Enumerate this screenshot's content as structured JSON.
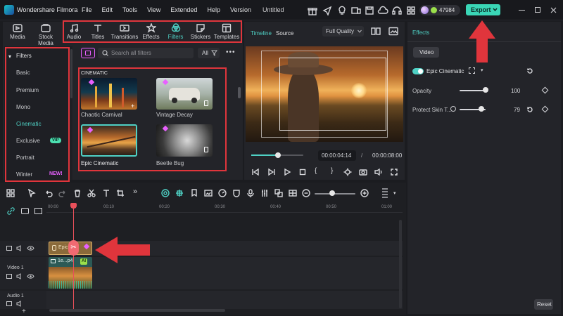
{
  "app": {
    "name": "Wondershare Filmora",
    "menu": [
      "File",
      "Edit",
      "Tools",
      "View",
      "Extended",
      "Help",
      "Version"
    ],
    "doc_title": "Untitled",
    "credits": "47984",
    "export_label": "Export"
  },
  "media_tabs": [
    {
      "label": "Media",
      "icon": "media-icon"
    },
    {
      "label": "Stock Media",
      "icon": "stock-media-icon"
    },
    {
      "label": "Audio",
      "icon": "audio-icon"
    },
    {
      "label": "Titles",
      "icon": "titles-icon"
    },
    {
      "label": "Transitions",
      "icon": "transitions-icon"
    },
    {
      "label": "Effects",
      "icon": "effects-icon"
    },
    {
      "label": "Filters",
      "icon": "filters-icon"
    },
    {
      "label": "Stickers",
      "icon": "stickers-icon"
    },
    {
      "label": "Templates",
      "icon": "templates-icon"
    }
  ],
  "filters_sidebar": {
    "header": "Filters",
    "items": [
      {
        "label": "Basic"
      },
      {
        "label": "Premium"
      },
      {
        "label": "Mono"
      },
      {
        "label": "Cinematic",
        "active": true
      },
      {
        "label": "Exclusive",
        "badge": "VIP"
      },
      {
        "label": "Portrait"
      },
      {
        "label": "Winter",
        "badge": "NEW!"
      }
    ]
  },
  "search": {
    "placeholder": "Search all filters",
    "filter_label": "All"
  },
  "filter_grid": {
    "section": "CINEMATIC",
    "items": [
      {
        "name": "Chaotic Carnival"
      },
      {
        "name": "Vintage Decay"
      },
      {
        "name": "Epic Cinematic",
        "selected": true
      },
      {
        "name": "Beetle Bug"
      }
    ]
  },
  "preview": {
    "tabs": [
      "Timeline",
      "Source"
    ],
    "active_tab": "Timeline",
    "quality": "Full Quality",
    "current_time": "00:00:04:14",
    "total_time": "00:00:08:00",
    "progress": 0.52
  },
  "effects_panel": {
    "title": "Effects",
    "tab": "Video",
    "effect_name": "Epic Cinematic",
    "enabled": true,
    "opacity_label": "Opacity",
    "opacity_value": "100",
    "protect_label": "Protect Skin T...",
    "protect_value": "79",
    "reset_label": "Reset"
  },
  "timeline": {
    "ruler": [
      "00:00",
      "00:10",
      "00:20",
      "00:30",
      "00:40",
      "00:50",
      "01:00"
    ],
    "tracks": [
      {
        "label": ""
      },
      {
        "label": "Video 1"
      },
      {
        "label": "Audio 1"
      }
    ],
    "effect_clip_label": "Epic...",
    "video_clip_label": "1e...p4",
    "ai_badge": "AI"
  },
  "colors": {
    "accent": "#4fd1c5",
    "red": "#e0353c",
    "export_bg": "#3ad6b6",
    "vip": "#4be0b0",
    "new": "#e860ff"
  }
}
